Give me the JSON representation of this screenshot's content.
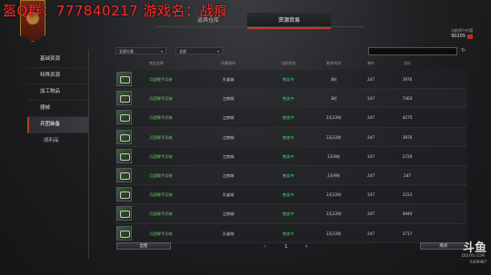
{
  "overlay": {
    "text": "盔Q群：777840217  游戏名：战痕"
  },
  "tabs": [
    {
      "label": "道具仓库"
    },
    {
      "label": "资源贸易"
    }
  ],
  "hud": {
    "label": "当前资产价值",
    "value": "90205"
  },
  "sidebar": {
    "items": [
      {
        "label": "基础资源"
      },
      {
        "label": "特殊资源"
      },
      {
        "label": "加工物品"
      },
      {
        "label": "器械"
      },
      {
        "label": "兵团装备"
      },
      {
        "label": "战利品"
      }
    ]
  },
  "filters": {
    "type_select": "全部分类",
    "city_select": "全部"
  },
  "table": {
    "headers": [
      "商品名称",
      "所属城市",
      "当前状态",
      "剩余时间",
      "单价",
      "总价"
    ],
    "rows": [
      {
        "name": "兵团弩手兵装",
        "city": "孔雀城",
        "status": "售卖中",
        "time": "4时",
        "price": "247",
        "total": "3976"
      },
      {
        "name": "兵团弩手兵装",
        "city": "江南城",
        "status": "售卖中",
        "time": "3时",
        "price": "247",
        "total": "7403"
      },
      {
        "name": "兵团弩手兵装",
        "city": "江南城",
        "status": "售卖中",
        "time": "2天22时",
        "price": "247",
        "total": "4275"
      },
      {
        "name": "兵团弩手兵装",
        "city": "江南城",
        "status": "售卖中",
        "time": "2天22时",
        "price": "247",
        "total": "3976"
      },
      {
        "name": "兵团弩手兵装",
        "city": "江南城",
        "status": "售卖中",
        "time": "2天9时",
        "price": "247",
        "total": "2729"
      },
      {
        "name": "兵团弩手兵装",
        "city": "江南城",
        "status": "售卖中",
        "time": "2天9时",
        "price": "247",
        "total": "247"
      },
      {
        "name": "兵团弩手兵装",
        "city": "孔雀城",
        "status": "售卖中",
        "time": "2天22时",
        "price": "247",
        "total": "2223"
      },
      {
        "name": "兵团弩手兵装",
        "city": "江南城",
        "status": "售卖中",
        "time": "2天22时",
        "price": "247",
        "total": "4940"
      },
      {
        "name": "兵团弩手兵装",
        "city": "孔雀城",
        "status": "售卖中",
        "time": "2天22时",
        "price": "247",
        "total": "2717"
      }
    ]
  },
  "footer": {
    "out_label": "出售",
    "buy_label": "购买",
    "page": "1"
  },
  "logo": {
    "main": "斗鱼",
    "sub": "DOUYU.COM",
    "id": "6300987"
  },
  "colors": {
    "accent": "#c0392b",
    "status_green": "#3ee05c",
    "overlay_red": "#ff2a2a"
  }
}
